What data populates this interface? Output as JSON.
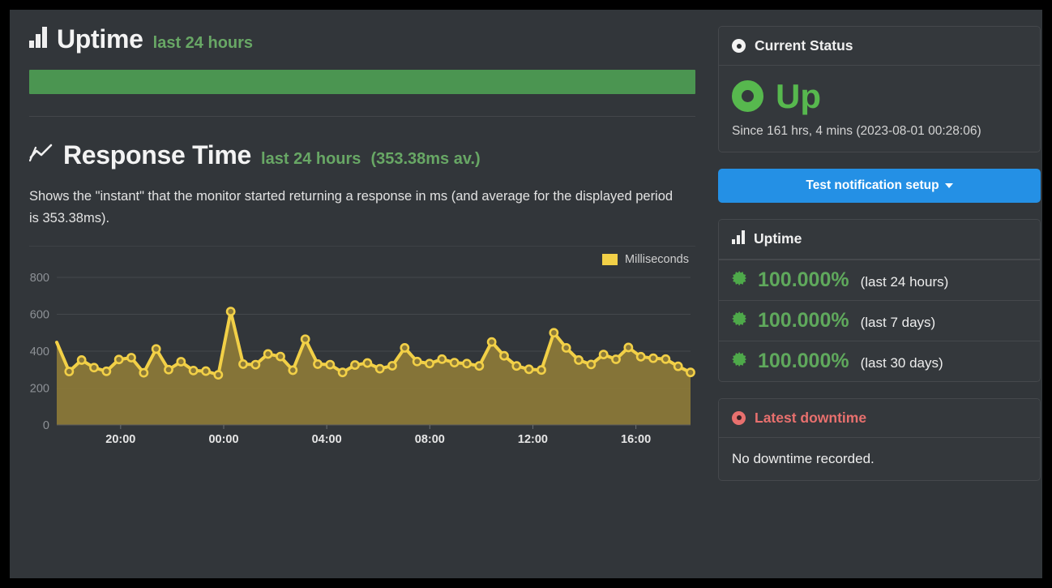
{
  "uptime_section": {
    "icon": "bar-chart-icon",
    "title": "Uptime",
    "subtitle": "last 24 hours",
    "bar_color": "#4b9551",
    "bar_fill_percent": "100"
  },
  "response_section": {
    "icon": "line-chart-icon",
    "title": "Response Time",
    "subtitle": "last 24 hours",
    "average_label": "(353.38ms av.)",
    "description": "Shows the \"instant\" that the monitor started returning a response in ms (and average for the displayed period is 353.38ms)."
  },
  "chart_data": {
    "type": "area",
    "title": "Response Time",
    "xlabel": "",
    "ylabel": "Milliseconds",
    "legend": [
      "Milliseconds"
    ],
    "legend_position": "top-right",
    "grid": true,
    "ylim": [
      0,
      800
    ],
    "yticks": [
      0,
      200,
      400,
      600,
      800
    ],
    "xticks": [
      "20:00",
      "00:00",
      "04:00",
      "08:00",
      "12:00",
      "16:00"
    ],
    "series": [
      {
        "name": "Milliseconds",
        "color": "#f2d047",
        "fill_color": "#8a7838",
        "values": [
          448,
          290,
          352,
          311,
          291,
          355,
          365,
          283,
          412,
          300,
          343,
          295,
          292,
          272,
          615,
          330,
          327,
          385,
          371,
          297,
          465,
          330,
          327,
          285,
          325,
          336,
          305,
          321,
          418,
          344,
          333,
          357,
          338,
          333,
          320,
          450,
          375,
          320,
          302,
          298,
          500,
          418,
          352,
          328,
          382,
          356,
          420,
          370,
          362,
          357,
          318,
          285
        ]
      }
    ]
  },
  "current_status": {
    "header_icon": "record-dot-icon",
    "header_title": "Current Status",
    "status_icon": "up-ring-icon",
    "status_text": "Up",
    "since_text": "Since 161 hrs, 4 mins (2023-08-01 00:28:06)",
    "status_color": "#57b84e"
  },
  "test_button": {
    "label": "Test notification setup",
    "caret_icon": "caret-down-icon",
    "color": "#2490e5"
  },
  "uptime_card": {
    "header_icon": "bar-chart-icon",
    "header_title": "Uptime",
    "rows": [
      {
        "icon": "burst-icon",
        "percent": "100.000%",
        "period": "(last 24 hours)"
      },
      {
        "icon": "burst-icon",
        "percent": "100.000%",
        "period": "(last 7 days)"
      },
      {
        "icon": "burst-icon",
        "percent": "100.000%",
        "period": "(last 30 days)"
      }
    ]
  },
  "downtime_card": {
    "header_icon": "record-dot-icon",
    "header_title": "Latest downtime",
    "body_text": "No downtime recorded.",
    "title_color": "#e8706e"
  }
}
